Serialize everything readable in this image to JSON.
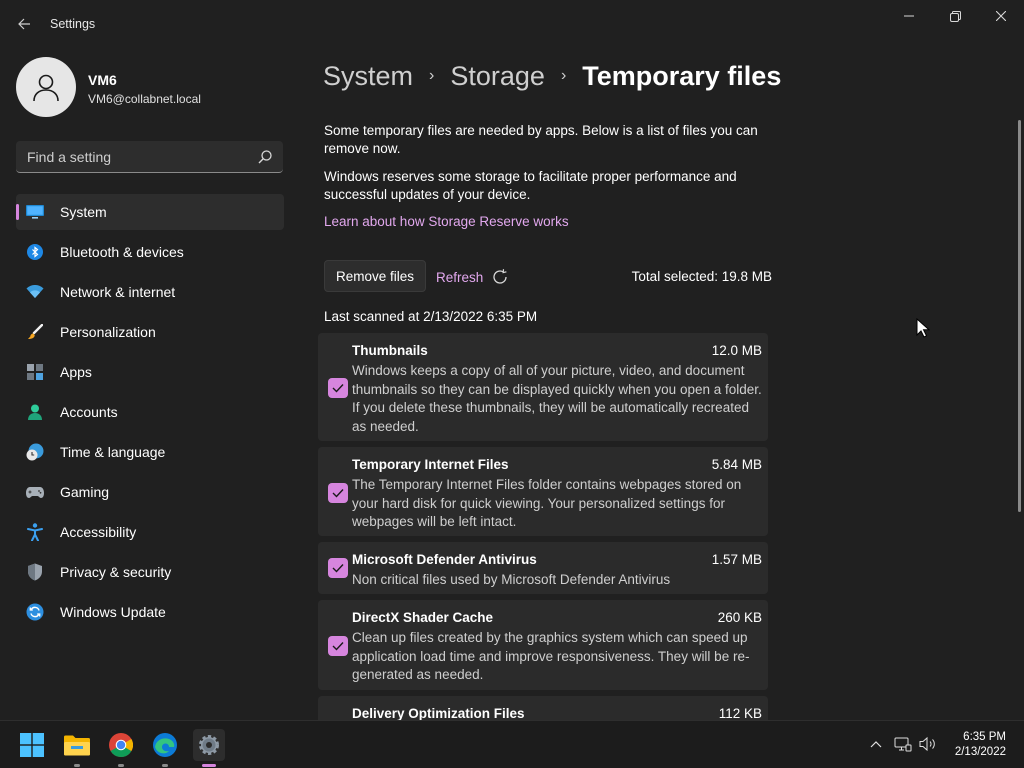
{
  "window": {
    "app_title": "Settings",
    "back_icon": "back-arrow-icon",
    "controls": [
      "minimize-icon",
      "maximize-icon",
      "close-icon"
    ]
  },
  "profile": {
    "name": "VM6",
    "email": "VM6@collabnet.local"
  },
  "search": {
    "placeholder": "Find a setting"
  },
  "sidebar": {
    "items": [
      {
        "label": "System",
        "icon": "monitor-icon",
        "active": true
      },
      {
        "label": "Bluetooth & devices",
        "icon": "bluetooth-icon"
      },
      {
        "label": "Network & internet",
        "icon": "wifi-icon"
      },
      {
        "label": "Personalization",
        "icon": "brush-icon"
      },
      {
        "label": "Apps",
        "icon": "apps-icon"
      },
      {
        "label": "Accounts",
        "icon": "person-icon"
      },
      {
        "label": "Time & language",
        "icon": "clock-globe-icon"
      },
      {
        "label": "Gaming",
        "icon": "gamepad-icon"
      },
      {
        "label": "Accessibility",
        "icon": "accessibility-icon"
      },
      {
        "label": "Privacy & security",
        "icon": "shield-icon"
      },
      {
        "label": "Windows Update",
        "icon": "update-icon"
      }
    ]
  },
  "breadcrumb": {
    "items": [
      "System",
      "Storage"
    ],
    "current": "Temporary files"
  },
  "main": {
    "intro_1": "Some temporary files are needed by apps. Below is a list of files you can remove now.",
    "intro_2": "Windows reserves some storage to facilitate proper performance and successful updates of your device.",
    "learn_link": "Learn about how Storage Reserve works",
    "remove_button": "Remove files",
    "refresh_button": "Refresh",
    "total_selected": "Total selected: 19.8 MB",
    "last_scanned": "Last scanned at 2/13/2022 6:35 PM"
  },
  "files": [
    {
      "name": "Thumbnails",
      "size": "12.0 MB",
      "checked": true,
      "description": "Windows keeps a copy of all of your picture, video, and document thumbnails so they can be displayed quickly when you open a folder. If you delete these thumbnails, they will be automatically recreated as needed."
    },
    {
      "name": "Temporary Internet Files",
      "size": "5.84 MB",
      "checked": true,
      "description": "The Temporary Internet Files folder contains webpages stored on your hard disk for quick viewing. Your personalized settings for webpages will be left intact."
    },
    {
      "name": "Microsoft Defender Antivirus",
      "size": "1.57 MB",
      "checked": true,
      "description": "Non critical files used by Microsoft Defender Antivirus"
    },
    {
      "name": "DirectX Shader Cache",
      "size": "260 KB",
      "checked": true,
      "description": "Clean up files created by the graphics system which can speed up application load time and improve responsiveness. They will be re-generated as needed."
    },
    {
      "name": "Delivery Optimization Files",
      "size": "112 KB",
      "checked": true,
      "description": ""
    }
  ],
  "taskbar": {
    "apps": [
      {
        "icon": "windows-start-icon"
      },
      {
        "icon": "file-explorer-icon",
        "open": true
      },
      {
        "icon": "chrome-icon",
        "open": true
      },
      {
        "icon": "edge-icon",
        "open": true
      },
      {
        "icon": "settings-gear-icon",
        "open": true,
        "active": true
      }
    ],
    "tray": [
      "chevron-up-icon",
      "network-icon",
      "volume-icon"
    ],
    "time": "6:35 PM",
    "date": "2/13/2022"
  },
  "colors": {
    "accent": "#d685de",
    "link": "#e2a8ee",
    "background": "#202020",
    "card": "#2b2b2b"
  }
}
